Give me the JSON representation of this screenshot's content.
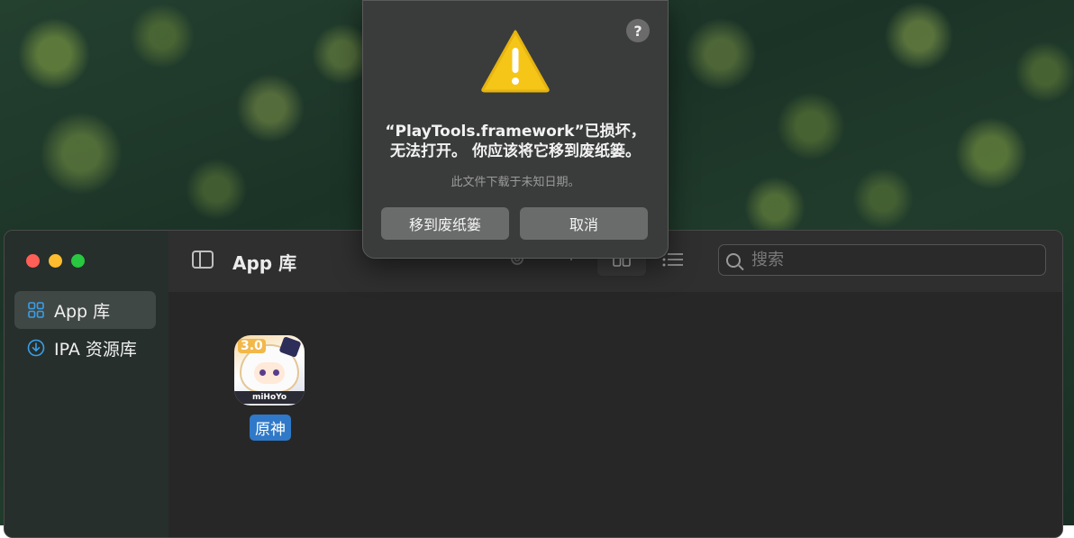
{
  "window": {
    "title": "App 库",
    "search_placeholder": "搜索"
  },
  "sidebar": {
    "items": [
      {
        "label": "App 库",
        "icon": "grid-icon",
        "active": true
      },
      {
        "label": "IPA 资源库",
        "icon": "download-circle-icon",
        "active": false
      }
    ]
  },
  "toolbar": {
    "icons": [
      "sidebar-toggle-icon",
      "gear-icon",
      "add-icon",
      "grid-view-icon",
      "list-view-icon"
    ]
  },
  "apps": [
    {
      "name": "原神",
      "icon_logo": "miHoYo",
      "icon_badge": "3.0"
    }
  ],
  "dialog": {
    "title_line1": "“PlayTools.framework”已损坏，",
    "title_line2": "无法打开。 你应该将它移到废纸篓。",
    "subtitle": "此文件下载于未知日期。",
    "move_button": "移到废纸篓",
    "cancel_button": "取消",
    "help": "?"
  },
  "colors": {
    "accent": "#2f79c8",
    "sidebar_icon": "#3a9ee8",
    "warning": "#f5c518"
  }
}
